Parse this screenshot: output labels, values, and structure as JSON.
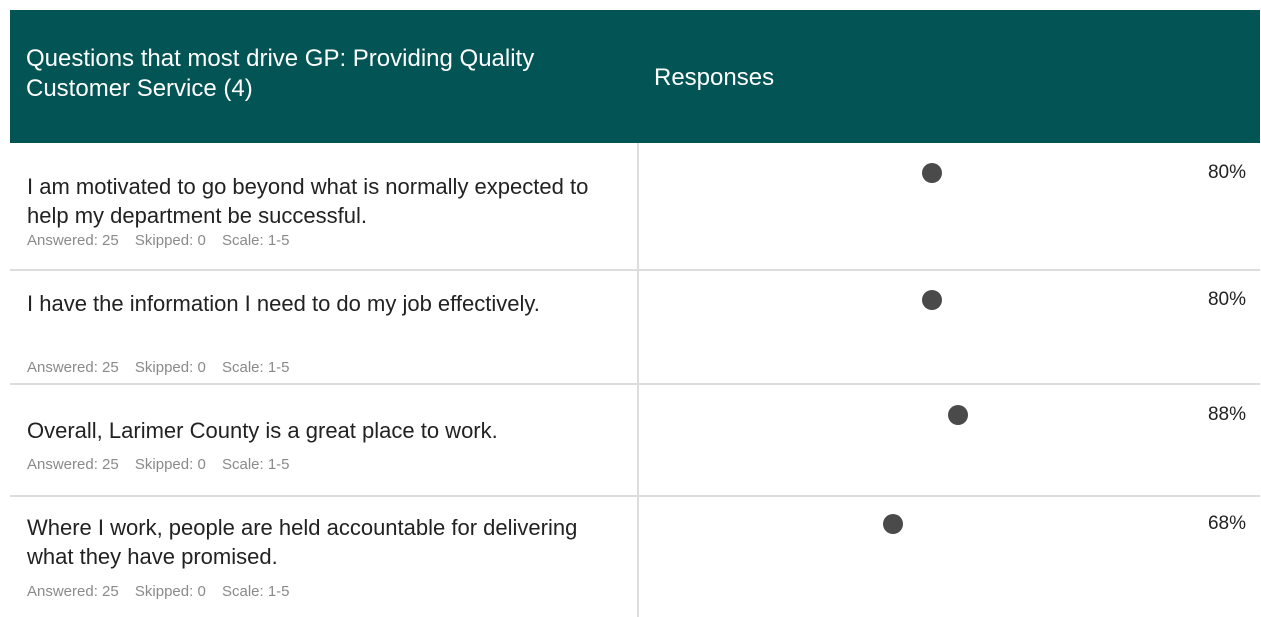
{
  "header": {
    "question_col": "Questions that most drive GP: Providing Quality Customer Service (4)",
    "responses_col": "Responses"
  },
  "meta_labels": {
    "answered": "Answered:",
    "skipped": "Skipped:",
    "scale": "Scale:"
  },
  "rows": [
    {
      "question": "I am motivated to go beyond what is normally expected to help my department be successful.",
      "answered": "Answered: 25",
      "skipped": "Skipped: 0",
      "scale": "Scale: 1-5",
      "percent": "80%",
      "value": 80
    },
    {
      "question": "I have the information I need to do my job effectively.",
      "answered": "Answered: 25",
      "skipped": "Skipped: 0",
      "scale": "Scale: 1-5",
      "percent": "80%",
      "value": 80
    },
    {
      "question": "Overall, Larimer County is a great place to work.",
      "answered": "Answered: 25",
      "skipped": "Skipped: 0",
      "scale": "Scale: 1-5",
      "percent": "88%",
      "value": 88
    },
    {
      "question": "Where I work, people are held accountable for delivering what they have promised.",
      "answered": "Answered: 25",
      "skipped": "Skipped: 0",
      "scale": "Scale: 1-5",
      "percent": "68%",
      "value": 68
    }
  ],
  "colors": {
    "header_bg": "#035454",
    "header_text": "#ffffff",
    "dot": "#4a4a4a",
    "border": "#dddddd"
  }
}
